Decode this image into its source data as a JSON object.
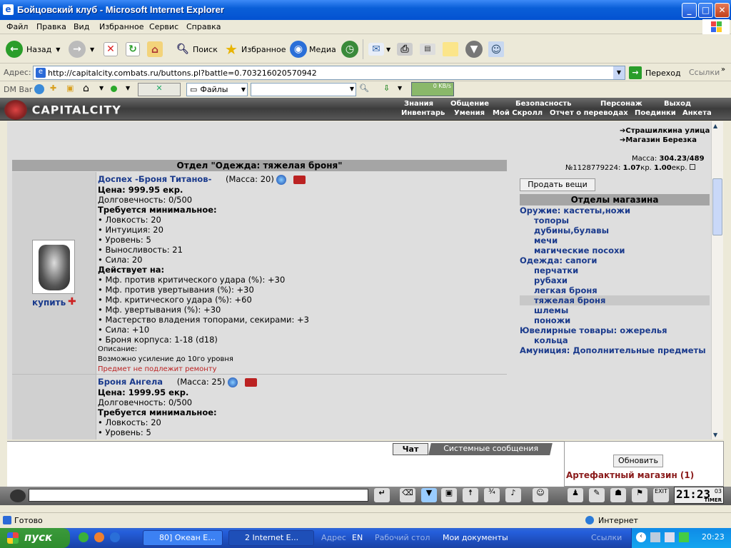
{
  "window": {
    "title": "Бойцовский клуб - Microsoft Internet Explorer"
  },
  "menu": [
    "Файл",
    "Правка",
    "Вид",
    "Избранное",
    "Сервис",
    "Справка"
  ],
  "toolbar": {
    "back": "Назад",
    "search": "Поиск",
    "favorites": "Избранное",
    "media": "Медиа"
  },
  "address": {
    "label": "Адрес:",
    "url": "http://capitalcity.combats.ru/buttons.pl?battle=0.70321602057094​2",
    "go": "Переход",
    "links": "Ссылки"
  },
  "dmbar": {
    "label": "DM Bar",
    "files": "Файлы",
    "speed": "0 KB/s"
  },
  "site": {
    "logo": "CAPITALCITY",
    "nav_top": [
      "Знания",
      "Общение",
      "Безопасность",
      "Персонаж",
      "Выход"
    ],
    "nav_bottom": [
      "Инвентарь",
      "Умения",
      "Мой Скролл",
      "Отчет о переводах",
      "Поединки",
      "Анкета"
    ]
  },
  "shop": {
    "links": [
      "Страшилкина улица",
      "Магазин Березка"
    ],
    "mass_label": "Масса:",
    "mass_value": "304.23/489",
    "account": "№1128779224:",
    "money": "1.07",
    "money_unit": "кр.",
    "ekr": "1.00",
    "ekr_unit": "екр.",
    "sell_button": "Продать вещи",
    "departments_title": "Отделы магазина",
    "departments": [
      {
        "label": "Оружие: кастеты,ножи",
        "indent": false
      },
      {
        "label": "топоры",
        "indent": true
      },
      {
        "label": "дубины,булавы",
        "indent": true
      },
      {
        "label": "мечи",
        "indent": true
      },
      {
        "label": "магические посохи",
        "indent": true
      },
      {
        "label": "Одежда: сапоги",
        "indent": false
      },
      {
        "label": "перчатки",
        "indent": true
      },
      {
        "label": "рубахи",
        "indent": true
      },
      {
        "label": "легкая броня",
        "indent": true
      },
      {
        "label": "тяжелая броня",
        "indent": true,
        "selected": true
      },
      {
        "label": "шлемы",
        "indent": true
      },
      {
        "label": "поножи",
        "indent": true
      },
      {
        "label": "Ювелирные товары: ожерелья",
        "indent": false
      },
      {
        "label": "кольца",
        "indent": true
      },
      {
        "label": "Амуниция: Дополнительные предметы",
        "indent": false
      }
    ],
    "section_title": "Отдел \"Одежда: тяжелая броня\"",
    "buy_label": "купить",
    "items": [
      {
        "name": "Доспех -Броня Титанов-",
        "mass": "(Масса: 20)",
        "price": "Цена: 999.95 екр.",
        "durability": "Долговечность: 0/500",
        "req_title": "Требуется минимальное:",
        "reqs": [
          "• Ловкость: 20",
          "• Интуиция: 20",
          "• Уровень: 5",
          "• Выносливость: 21",
          "• Сила: 20"
        ],
        "eff_title": "Действует на:",
        "effects": [
          "• Мф. против критического удара (%): +30",
          "• Мф. против увертывания (%): +30",
          "• Мф. критического удара (%): +60",
          "• Мф. увертывания (%): +30",
          "• Мастерство владения топорами, секирами: +3",
          "• Сила: +10",
          "• Броня корпуса: 1-18 (d18)"
        ],
        "desc_title": "Описание:",
        "desc": "Возможно усиление до 10го уровня",
        "repair": "Предмет не подлежит ремонту"
      },
      {
        "name": "Броня Ангела",
        "mass": "(Масса: 25)",
        "price": "Цена: 1999.95 екр.",
        "durability": "Долговечность: 0/500",
        "req_title": "Требуется минимальное:",
        "reqs": [
          "• Ловкость: 20",
          "• Уровень: 5"
        ]
      }
    ]
  },
  "chat": {
    "tab_chat": "Чат",
    "tab_system": "Системные сообщения",
    "refresh": "Обновить",
    "room": "Артефактный магазин (1)",
    "time": "21:23",
    "seconds": "03",
    "timer": "TIMER"
  },
  "status": {
    "ready": "Готово",
    "zone": "Интернет"
  },
  "taskbar": {
    "start": "пуск",
    "task1": "80] Океан Е...",
    "task2": "2 Internet E...",
    "addr": "Адрес",
    "lang": "EN",
    "desktop": "Рабочий стол",
    "docs": "Мои документы",
    "links": "Ссылки",
    "clock": "20:23"
  }
}
